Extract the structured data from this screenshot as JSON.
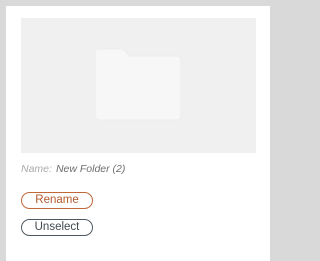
{
  "file": {
    "name_label": "Name:",
    "name_value": "New Folder (2)",
    "type_icon": "folder-icon"
  },
  "actions": {
    "rename_label": "Rename",
    "unselect_label": "Unselect"
  },
  "colors": {
    "rename_accent": "#c0683a",
    "unselect_accent": "#4f5a60",
    "preview_bg": "#f0f0f0",
    "folder_fill": "#f7f7f7"
  }
}
